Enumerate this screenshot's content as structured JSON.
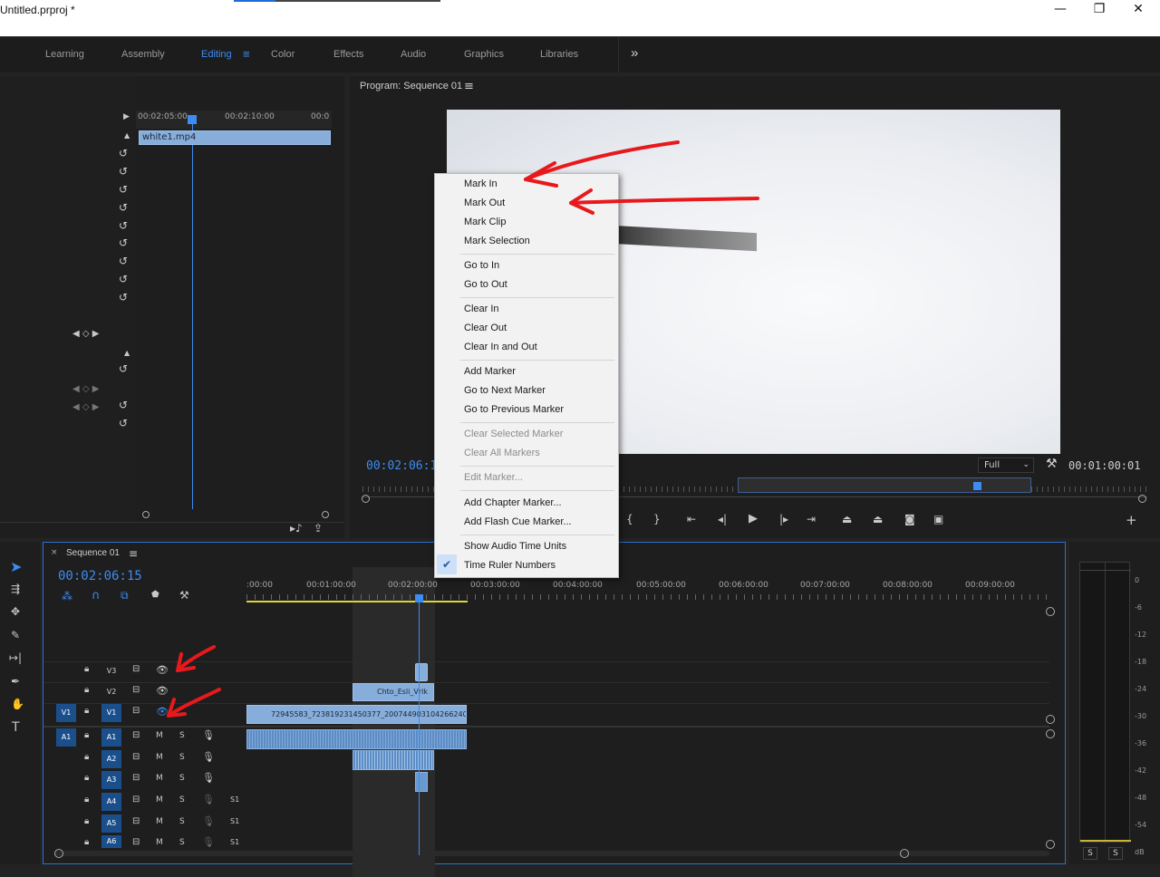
{
  "window": {
    "title": "Untitled.prproj *",
    "min": "—",
    "max": "❐",
    "close": "✕"
  },
  "workspaces": {
    "tabs": [
      "Learning",
      "Assembly",
      "Editing",
      "Color",
      "Effects",
      "Audio",
      "Graphics",
      "Libraries"
    ],
    "active": "Editing",
    "menu_glyph": "≡",
    "more_glyph": "»"
  },
  "source": {
    "ruler": [
      "00:02:05:00",
      "00:02:10:00",
      "00:0"
    ],
    "clip_name": "white1.mp4"
  },
  "program": {
    "title": "Program: Sequence 01",
    "menu_glyph": "≡",
    "timecode": "00:02:06:15",
    "zoom": "Full",
    "duration": "00:01:00:01"
  },
  "context_menu": {
    "items": [
      {
        "label": "Mark In",
        "enabled": true
      },
      {
        "label": "Mark Out",
        "enabled": true
      },
      {
        "label": "Mark Clip",
        "enabled": true
      },
      {
        "label": "Mark Selection",
        "enabled": true
      },
      {
        "label": "Go to In",
        "enabled": true
      },
      {
        "label": "Go to Out",
        "enabled": true
      },
      {
        "label": "Clear In",
        "enabled": true
      },
      {
        "label": "Clear Out",
        "enabled": true
      },
      {
        "label": "Clear In and Out",
        "enabled": true
      },
      {
        "label": "Add Marker",
        "enabled": true
      },
      {
        "label": "Go to Next Marker",
        "enabled": true
      },
      {
        "label": "Go to Previous Marker",
        "enabled": true
      },
      {
        "label": "Clear Selected Marker",
        "enabled": false
      },
      {
        "label": "Clear All Markers",
        "enabled": false
      },
      {
        "label": "Edit Marker...",
        "enabled": false
      },
      {
        "label": "Add Chapter Marker...",
        "enabled": true
      },
      {
        "label": "Add Flash Cue Marker...",
        "enabled": true
      },
      {
        "label": "Show Audio Time Units",
        "enabled": true
      },
      {
        "label": "Time Ruler Numbers",
        "enabled": true,
        "checked": true
      }
    ]
  },
  "timeline": {
    "tab_close": "×",
    "tab_label": "Sequence 01",
    "menu_glyph": "≡",
    "timecode": "00:02:06:15",
    "ruler": [
      ":00:00",
      "00:01:00:00",
      "00:02:00:00",
      "00:03:00:00",
      "00:04:00:00",
      "00:05:00:00",
      "00:06:00:00",
      "00:07:00:00",
      "00:08:00:00",
      "00:09:00:00"
    ],
    "video_tracks": [
      "V3",
      "V2",
      "V1"
    ],
    "audio_tracks": [
      "A1",
      "A2",
      "A3",
      "A4",
      "A5",
      "A6"
    ],
    "source_patch_v": "V1",
    "source_patch_a": "A1",
    "mute": "M",
    "solo": "S",
    "a_extra": "S1",
    "clips": {
      "v2": "Chto_Esli_Vrlk",
      "v1": "72945583_723819231450377_2007449031042662400"
    }
  },
  "meters": {
    "scale": [
      "0",
      "-6",
      "-12",
      "-18",
      "-24",
      "-30",
      "-36",
      "-42",
      "-48",
      "-54",
      "dB"
    ],
    "solo_left": "S",
    "solo_right": "S"
  },
  "colors": {
    "accent": "#3d8cf0",
    "annotation": "#e8191c"
  }
}
